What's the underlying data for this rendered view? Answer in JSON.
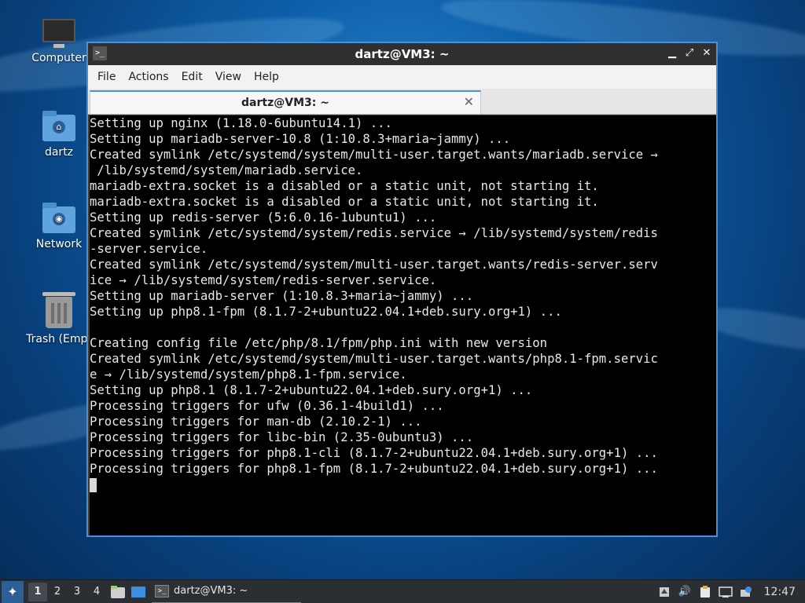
{
  "desktop": {
    "icons": [
      {
        "label": "Computer",
        "icon": "computer-icon"
      },
      {
        "label": "dartz",
        "icon": "home-folder-icon"
      },
      {
        "label": "Network",
        "icon": "network-folder-icon"
      },
      {
        "label": "Trash (Empt",
        "icon": "trash-icon"
      }
    ]
  },
  "window": {
    "title": "dartz@VM3: ~",
    "controls": {
      "minimize": "▁",
      "maximize": "⤢",
      "close": "✕"
    },
    "menu": [
      "File",
      "Actions",
      "Edit",
      "View",
      "Help"
    ],
    "tab": {
      "label": "dartz@VM3: ~",
      "close": "✕"
    },
    "terminal_lines": [
      "Setting up nginx (1.18.0-6ubuntu14.1) ...",
      "Setting up mariadb-server-10.8 (1:10.8.3+maria~jammy) ...",
      "Created symlink /etc/systemd/system/multi-user.target.wants/mariadb.service →",
      " /lib/systemd/system/mariadb.service.",
      "mariadb-extra.socket is a disabled or a static unit, not starting it.",
      "mariadb-extra.socket is a disabled or a static unit, not starting it.",
      "Setting up redis-server (5:6.0.16-1ubuntu1) ...",
      "Created symlink /etc/systemd/system/redis.service → /lib/systemd/system/redis",
      "-server.service.",
      "Created symlink /etc/systemd/system/multi-user.target.wants/redis-server.serv",
      "ice → /lib/systemd/system/redis-server.service.",
      "Setting up mariadb-server (1:10.8.3+maria~jammy) ...",
      "Setting up php8.1-fpm (8.1.7-2+ubuntu22.04.1+deb.sury.org+1) ...",
      "",
      "Creating config file /etc/php/8.1/fpm/php.ini with new version",
      "Created symlink /etc/systemd/system/multi-user.target.wants/php8.1-fpm.servic",
      "e → /lib/systemd/system/php8.1-fpm.service.",
      "Setting up php8.1 (8.1.7-2+ubuntu22.04.1+deb.sury.org+1) ...",
      "Processing triggers for ufw (0.36.1-4build1) ...",
      "Processing triggers for man-db (2.10.2-1) ...",
      "Processing triggers for libc-bin (2.35-0ubuntu3) ...",
      "Processing triggers for php8.1-cli (8.1.7-2+ubuntu22.04.1+deb.sury.org+1) ...",
      "Processing triggers for php8.1-fpm (8.1.7-2+ubuntu22.04.1+deb.sury.org+1) ..."
    ]
  },
  "panel": {
    "workspaces": [
      "1",
      "2",
      "3",
      "4"
    ],
    "active_workspace": "1",
    "task_label": "dartz@VM3: ~",
    "clock": "12:47"
  },
  "colors": {
    "accent": "#4a90d9",
    "terminal_bg": "#000000",
    "panel_bg": "#2b2e33"
  }
}
